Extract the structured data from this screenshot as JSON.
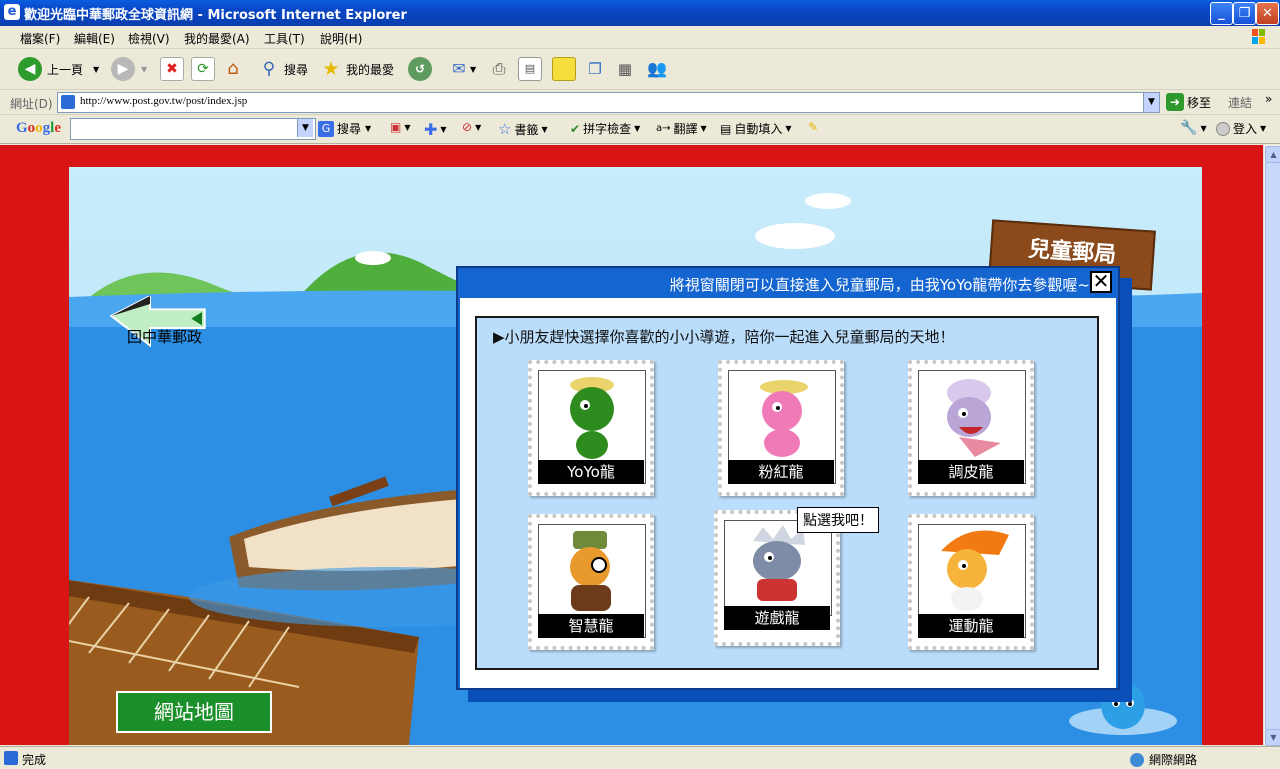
{
  "window": {
    "title": "歡迎光臨中華郵政全球資訊網 - Microsoft Internet Explorer"
  },
  "menu": [
    "檔案(F)",
    "編輯(E)",
    "檢視(V)",
    "我的最愛(A)",
    "工具(T)",
    "說明(H)"
  ],
  "toolbar": {
    "back_label": "上一頁",
    "search_label": "搜尋",
    "favorites_label": "我的最愛"
  },
  "address": {
    "label": "網址(D)",
    "url": "http://www.post.gov.tw/post/index.jsp",
    "go_label": "移至",
    "links_label": "連結"
  },
  "googlebar": {
    "logo": "Google",
    "search_label": "搜尋",
    "bookmarks_label": "書籤",
    "spellcheck_label": "拼字檢查",
    "translate_label": "翻譯",
    "autofill_label": "自動填入",
    "signin_label": "登入"
  },
  "page": {
    "back_sign": "回中華郵政",
    "sitemap": "網站地圖",
    "kids_sign": "兒童郵局",
    "tooltip": "點選我吧！"
  },
  "dialog": {
    "header": "將視窗關閉可以直接進入兒童郵局，由我YoYo龍帶你去參觀喔~",
    "close_glyph": "✕",
    "instruction": "▶小朋友趕快選擇你喜歡的小小導遊，陪你一起進入兒童郵局的天地！",
    "guides": [
      {
        "name": "YoYo龍",
        "color": "#2e8b1e",
        "hat": "#e9d36a"
      },
      {
        "name": "粉紅龍",
        "color": "#f07ab8",
        "hat": "#e9d36a"
      },
      {
        "name": "調皮龍",
        "color": "#b9a5d6",
        "hat": "#d8c8ec"
      },
      {
        "name": "智慧龍",
        "color": "#e89a2c",
        "hat": "#6f8a3a"
      },
      {
        "name": "遊戲龍",
        "color": "#7e8ca8",
        "hat": "#cfd6e2"
      },
      {
        "name": "運動龍",
        "color": "#f6b43a",
        "hat": "#f27a12"
      }
    ]
  },
  "status": {
    "text": "完成",
    "zone": "網際網路"
  },
  "colors": {
    "page_bg": "#d81414",
    "dialog_blue": "#1565d0",
    "inner_panel": "#b9ddfa"
  }
}
